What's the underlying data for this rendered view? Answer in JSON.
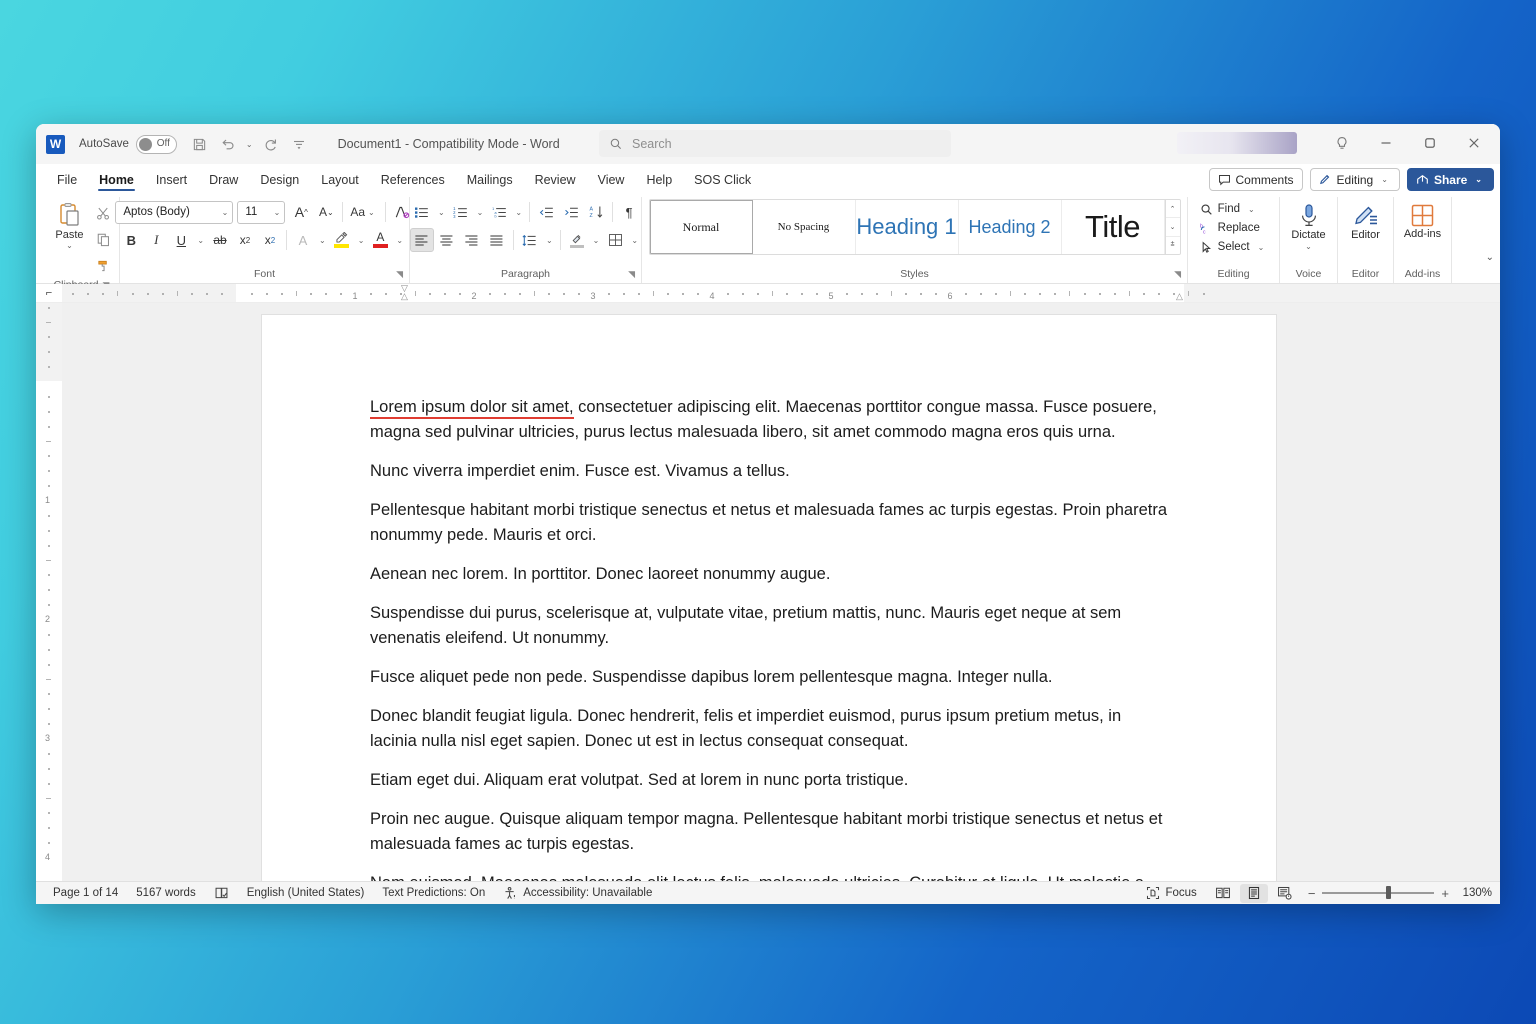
{
  "titlebar": {
    "app_icon": "word-logo-icon",
    "autosave_label": "AutoSave",
    "autosave_state": "Off",
    "save_icon": "save-icon",
    "undo_icon": "undo-icon",
    "redo_icon": "redo-icon",
    "customize_qat_icon": "customize-quick-access-toolbar-icon",
    "document_title": "Document1  -  Compatibility Mode  -  Word",
    "minimize_icon": "minimize-icon",
    "restore_icon": "restore-icon",
    "close_icon": "close-icon",
    "help_icon": "lightbulb-help-icon"
  },
  "search": {
    "placeholder": "Search",
    "icon": "search-icon"
  },
  "tabs": [
    {
      "label": "File",
      "active": false
    },
    {
      "label": "Home",
      "active": true
    },
    {
      "label": "Insert",
      "active": false
    },
    {
      "label": "Draw",
      "active": false
    },
    {
      "label": "Design",
      "active": false
    },
    {
      "label": "Layout",
      "active": false
    },
    {
      "label": "References",
      "active": false
    },
    {
      "label": "Mailings",
      "active": false
    },
    {
      "label": "Review",
      "active": false
    },
    {
      "label": "View",
      "active": false
    },
    {
      "label": "Help",
      "active": false
    },
    {
      "label": "SOS Click",
      "active": false
    }
  ],
  "tabstrip_right": {
    "comments_label": "Comments",
    "comments_icon": "comment-icon",
    "editing_label": "Editing",
    "editing_icon": "pencil-icon",
    "share_label": "Share",
    "share_icon": "share-icon"
  },
  "ribbon": {
    "clipboard": {
      "group_label": "Clipboard",
      "paste_label": "Paste",
      "paste_icon": "paste-icon",
      "cut_icon": "scissors-cut-icon",
      "copy_icon": "copy-icon",
      "format_painter_icon": "format-painter-icon"
    },
    "font": {
      "group_label": "Font",
      "font_name": "Aptos (Body)",
      "font_size": "11",
      "grow_font_icon": "grow-font-icon",
      "shrink_font_icon": "shrink-font-icon",
      "change_case_label": "Aa",
      "clear_formatting_icon": "clear-formatting-icon",
      "bold_label": "B",
      "italic_label": "I",
      "underline_label": "U",
      "strikethrough_icon": "strikethrough-icon",
      "subscript_label": "x",
      "superscript_label": "x",
      "text_effects_label": "A",
      "highlight_icon": "text-highlight-color-icon",
      "font_color_label": "A",
      "highlight_color": "#ffe600",
      "font_color": "#e02020"
    },
    "paragraph": {
      "group_label": "Paragraph",
      "bullets_icon": "bullets-icon",
      "numbering_icon": "numbering-icon",
      "multilevel_icon": "multilevel-list-icon",
      "decrease_indent_icon": "decrease-indent-icon",
      "increase_indent_icon": "increase-indent-icon",
      "sort_icon": "sort-icon",
      "show_marks_label": "¶",
      "align_left_icon": "align-left-icon",
      "align_center_icon": "align-center-icon",
      "align_right_icon": "align-right-icon",
      "justify_icon": "justify-icon",
      "line_spacing_icon": "line-spacing-icon",
      "shading_icon": "shading-icon",
      "borders_icon": "borders-icon"
    },
    "styles": {
      "group_label": "Styles",
      "items": [
        {
          "name": "Normal",
          "selected": true
        },
        {
          "name": "No Spacing",
          "selected": false
        },
        {
          "name": "Heading 1",
          "selected": false
        },
        {
          "name": "Heading 2",
          "selected": false
        },
        {
          "name": "Title",
          "selected": false
        }
      ]
    },
    "editing": {
      "group_label": "Editing",
      "find_label": "Find",
      "find_icon": "find-magnifier-icon",
      "replace_label": "Replace",
      "replace_icon": "replace-icon",
      "select_label": "Select",
      "select_icon": "select-arrow-icon"
    },
    "voice": {
      "group_label": "Voice",
      "dictate_label": "Dictate",
      "dictate_icon": "microphone-icon"
    },
    "editor_group": {
      "group_label": "Editor",
      "editor_label": "Editor",
      "editor_icon": "editor-pen-icon"
    },
    "addins": {
      "group_label": "Add-ins",
      "addins_label": "Add-ins",
      "addins_icon": "add-ins-grid-icon"
    },
    "collapse_icon": "collapse-ribbon-chevron-icon"
  },
  "ruler": {
    "tab_selector_icon": "tab-stop-left-icon",
    "h_ticks": [
      "1",
      "2",
      "3",
      "4",
      "5",
      "6"
    ],
    "v_ticks": [
      "1",
      "2",
      "3",
      "4"
    ],
    "first_line_indent_icon": "first-line-indent-marker",
    "left_indent_icon": "left-indent-marker",
    "right_indent_icon": "right-indent-marker"
  },
  "document": {
    "paragraphs": [
      {
        "highlighted": "Lorem ipsum dolor sit amet,",
        "rest": " consectetuer adipiscing elit. Maecenas porttitor congue massa. Fusce posuere, magna sed pulvinar ultricies, purus lectus malesuada libero, sit amet commodo magna eros quis urna."
      },
      {
        "highlighted": "",
        "rest": "Nunc viverra imperdiet enim. Fusce est. Vivamus a tellus."
      },
      {
        "highlighted": "",
        "rest": "Pellentesque habitant morbi tristique senectus et netus et malesuada fames ac turpis egestas. Proin pharetra nonummy pede. Mauris et orci."
      },
      {
        "highlighted": "",
        "rest": "Aenean nec lorem. In porttitor. Donec laoreet nonummy augue."
      },
      {
        "highlighted": "",
        "rest": "Suspendisse dui purus, scelerisque at, vulputate vitae, pretium mattis, nunc. Mauris eget neque at sem venenatis eleifend. Ut nonummy."
      },
      {
        "highlighted": "",
        "rest": "Fusce aliquet pede non pede. Suspendisse dapibus lorem pellentesque magna. Integer nulla."
      },
      {
        "highlighted": "",
        "rest": "Donec blandit feugiat ligula. Donec hendrerit, felis et imperdiet euismod, purus ipsum pretium metus, in lacinia nulla nisl eget sapien. Donec ut est in lectus consequat consequat."
      },
      {
        "highlighted": "",
        "rest": "Etiam eget dui. Aliquam erat volutpat. Sed at lorem in nunc porta tristique."
      },
      {
        "highlighted": "",
        "rest": "Proin nec augue. Quisque aliquam tempor magna. Pellentesque habitant morbi tristique senectus et netus et malesuada fames ac turpis egestas."
      },
      {
        "highlighted": "",
        "rest": "Nam euismod. Maecenas malesuada elit lectus felis, malesuada ultricies. Curabitur et ligula. Ut molestie a, ultricies porta urna. Vestibulum commodo volutpat a, convallis ac, laoreet enim."
      }
    ]
  },
  "statusbar": {
    "page_label": "Page 1 of 14",
    "words_label": "5167 words",
    "proofing_icon": "proofing-errors-icon",
    "language_label": "English (United States)",
    "predictions_label": "Text Predictions: On",
    "accessibility_icon": "accessibility-icon",
    "accessibility_label": "Accessibility: Unavailable",
    "focus_label": "Focus",
    "focus_icon": "focus-mode-icon",
    "read_mode_icon": "read-mode-icon",
    "print_layout_icon": "print-layout-icon",
    "web_layout_icon": "web-layout-icon",
    "zoom_out_label": "−",
    "zoom_in_label": "+",
    "zoom_level": "130%"
  }
}
